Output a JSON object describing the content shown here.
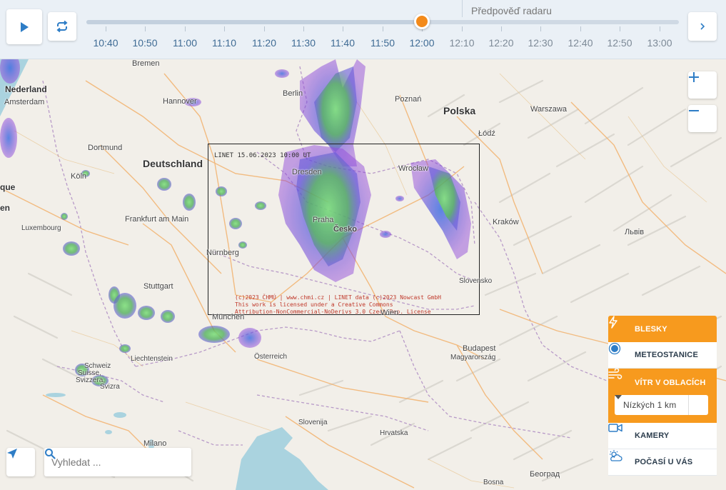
{
  "timeline": {
    "forecast_label": "Předpověď radaru",
    "times": [
      {
        "label": "10:40",
        "future": false
      },
      {
        "label": "10:50",
        "future": false
      },
      {
        "label": "11:00",
        "future": false
      },
      {
        "label": "11:10",
        "future": false
      },
      {
        "label": "11:20",
        "future": false
      },
      {
        "label": "11:30",
        "future": false
      },
      {
        "label": "11:40",
        "future": false
      },
      {
        "label": "11:50",
        "future": false
      },
      {
        "label": "12:00",
        "future": false
      },
      {
        "label": "12:10",
        "future": true
      },
      {
        "label": "12:20",
        "future": true
      },
      {
        "label": "12:30",
        "future": true
      },
      {
        "label": "12:40",
        "future": true
      },
      {
        "label": "12:50",
        "future": true
      },
      {
        "label": "13:00",
        "future": true
      }
    ],
    "current_label": "12:00",
    "accent_color": "#f38a1a"
  },
  "map": {
    "places": {
      "bremen": "Bremen",
      "nederland": "Nederland",
      "amsterdam": "Amsterdam",
      "hannover": "Hannover",
      "berlin": "Berlin",
      "poznan": "Poznań",
      "polska": "Polska",
      "warszawa": "Warszawa",
      "lodz": "Łódź",
      "dortmund": "Dortmund",
      "deutschland": "Deutschland",
      "koln": "Köln",
      "que": "que",
      "en": "en",
      "dresden": "Dresden",
      "wroclaw": "Wrocław",
      "frankfurt": "Frankfurt am Main",
      "luxembourg": "Luxembourg",
      "praha": "Praha",
      "cesko": "Česko",
      "krakow": "Kraków",
      "lviv": "Львів",
      "nurnberg": "Nürnberg",
      "slovensko": "Slovensko",
      "stuttgart": "Stuttgart",
      "munchen": "München",
      "wien": "Wien",
      "osterreich": "Österreich",
      "liechtenstein": "Liechtenstein",
      "budapest": "Budapest",
      "magyarorszag": "Magyarország",
      "schweiz": "Schweiz",
      "suisse": "Suisse,",
      "svizzera": "Svizzera,",
      "svizra": "Svizra",
      "slovenija": "Slovenija",
      "hrvatska": "Hrvatska",
      "milano": "Milano",
      "bosna": "Bosna",
      "beograd": "Београд"
    },
    "radar_stamp": "LINET  15.06.2023 10:00 UT",
    "copyright_lines": "(c)2023 ČHMÚ | www.chmi.cz | LINET data (c)2023 Nowcast GmbH\nThis work is licensed under a Creative Commons\nAttribution-NonCommercial-NoDerivs 3.0 Czech Rep. License",
    "zoom_in": "+",
    "zoom_out": "−"
  },
  "search": {
    "placeholder": "Vyhledat ..."
  },
  "layers": {
    "blesky": "Blesky",
    "meteostanice": "Meteostanice",
    "vitr": "Vítr v oblacích",
    "vitr_select": "Nízkých 1 km",
    "kamery": "Kamery",
    "pocasi": "Počasí u vás"
  }
}
